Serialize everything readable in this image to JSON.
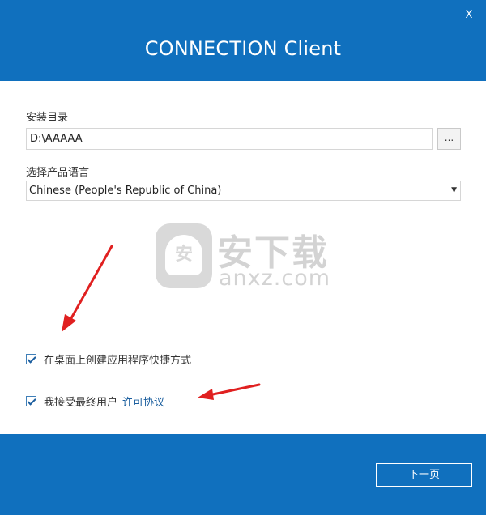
{
  "window": {
    "title": "CONNECTION Client",
    "minimize_label": "–",
    "close_label": "X"
  },
  "install": {
    "dir_label": "安装目录",
    "dir_value": "D:\\AAAAA",
    "browse_label": "..."
  },
  "language": {
    "label": "选择产品语言",
    "selected": "Chinese (People's Republic of China)"
  },
  "options": {
    "shortcut_label": "在桌面上创建应用程序快捷方式",
    "shortcut_checked": true,
    "agree_label": "我接受最终用户",
    "agree_link": "许可协议",
    "agree_checked": true
  },
  "watermark": {
    "badge": "安",
    "cn": "安下载",
    "en": "anxz.com"
  },
  "footer": {
    "next_label": "下一页"
  },
  "colors": {
    "brand_blue": "#1070be",
    "annotation_red": "#e02020"
  }
}
